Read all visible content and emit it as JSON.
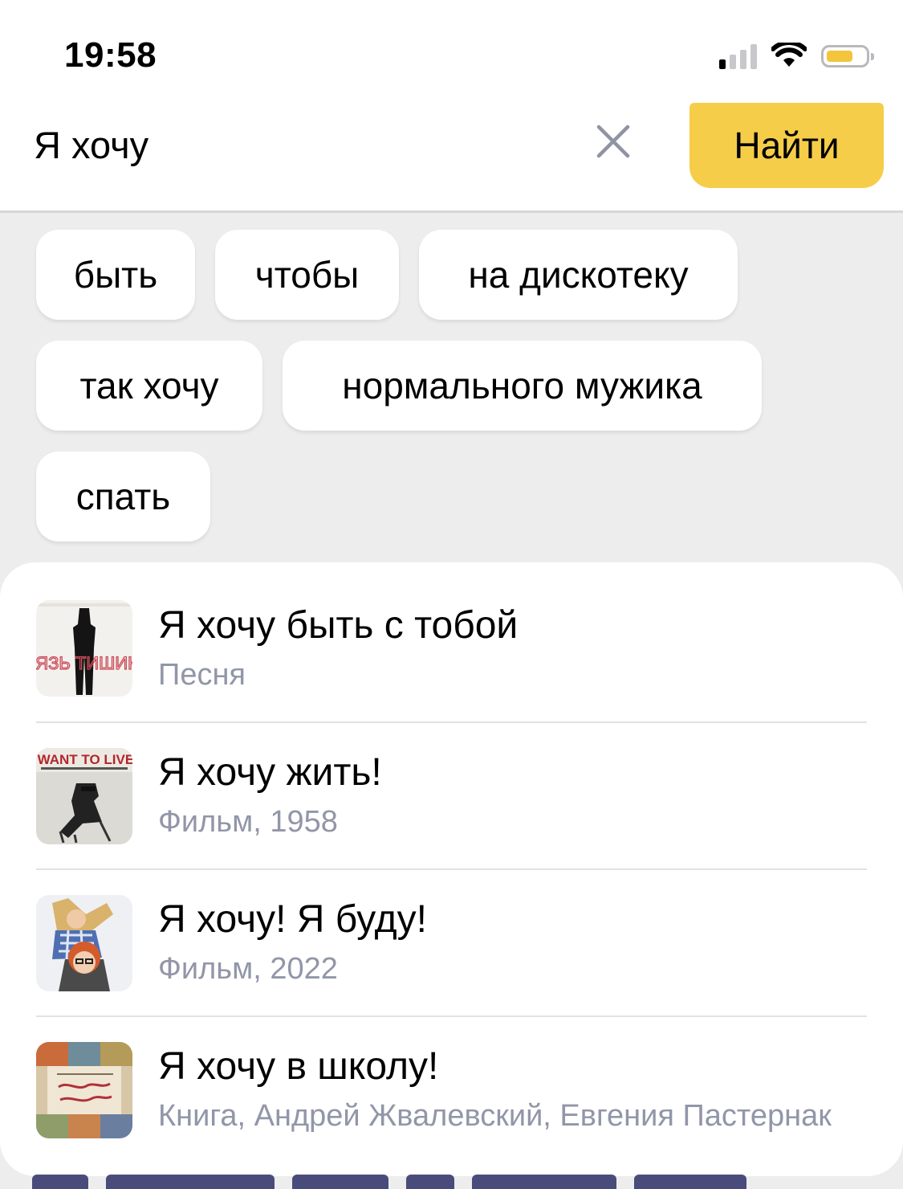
{
  "status_bar": {
    "time": "19:58",
    "icons": [
      "cellular-signal-icon",
      "wifi-icon",
      "battery-icon"
    ],
    "battery_color": "#f2c53d"
  },
  "search": {
    "query": "Я хочу",
    "clear_icon": "close-icon",
    "find_label": "Найти",
    "accent_color": "#f5cd49"
  },
  "suggestions": [
    "быть",
    "чтобы",
    "на дискотеку",
    "так хочу",
    "нормального мужика",
    "спать"
  ],
  "results": [
    {
      "title": "Я хочу быть с тобой",
      "subtitle": "Песня",
      "thumb_icon": "album-cover-knyaz-tishiny"
    },
    {
      "title": "Я хочу жить!",
      "subtitle": "Фильм, 1958",
      "thumb_icon": "movie-poster-i-want-to-live"
    },
    {
      "title": "Я хочу! Я буду!",
      "subtitle": "Фильм, 2022",
      "thumb_icon": "movie-poster-ya-hochu-ya-budu"
    },
    {
      "title": "Я хочу в школу!",
      "subtitle": "Книга, Андрей Жвалевский, Евгения Пастернак",
      "thumb_icon": "book-cover-ya-hochu-v-shkolu"
    }
  ],
  "thumb_text": {
    "album_cover": "КНЯЗЬ ТИШИНЫ",
    "poster": "I WANT TO LIVE!"
  }
}
